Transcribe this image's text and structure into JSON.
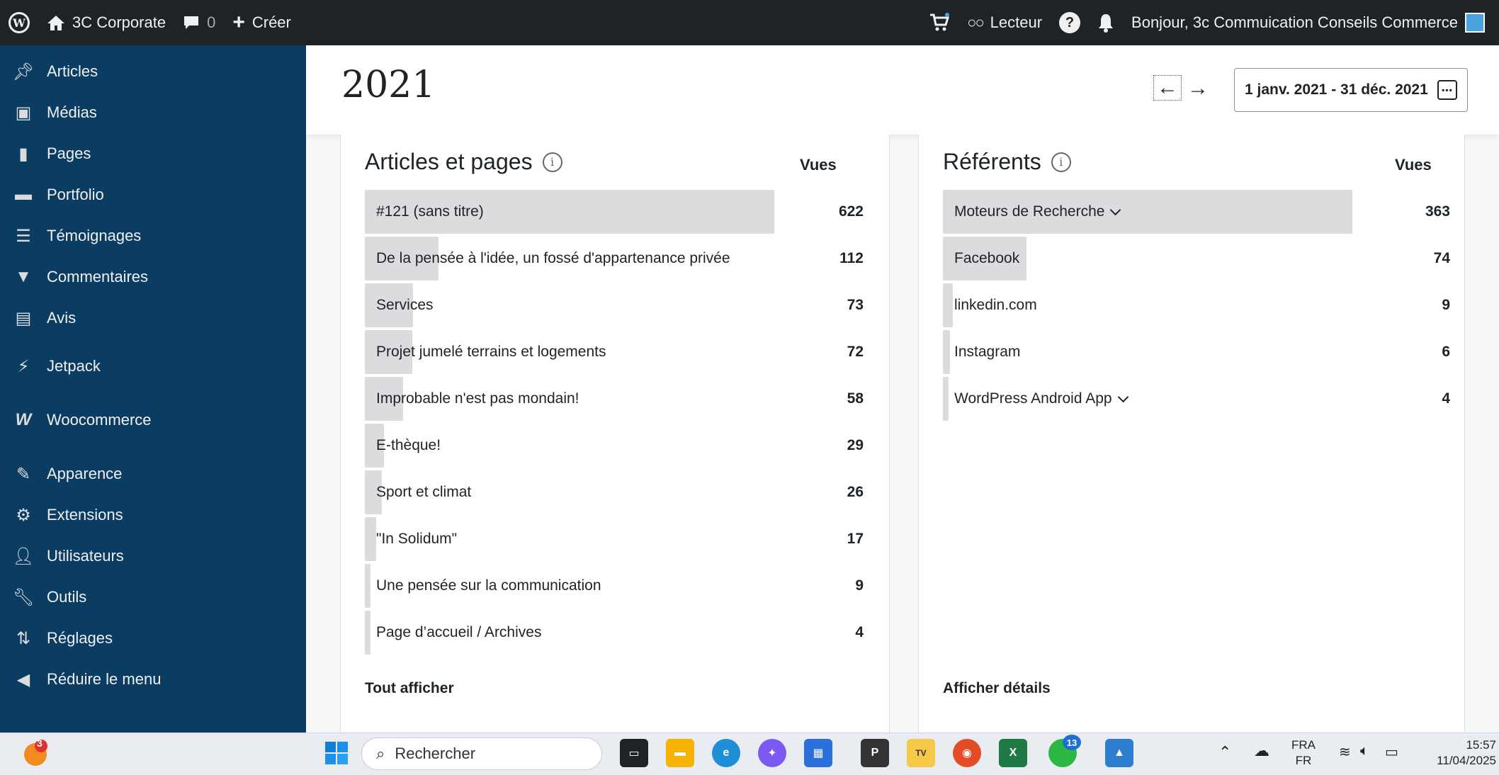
{
  "adminbar": {
    "site_name": "3C Corporate",
    "comments_count": "0",
    "create_label": "Créer",
    "reader_label": "Lecteur",
    "greeting": "Bonjour, 3c Commuication Conseils Commerce"
  },
  "sidebar": {
    "items": [
      {
        "label": "Articles",
        "icon": "pin-icon"
      },
      {
        "label": "Médias",
        "icon": "media-icon"
      },
      {
        "label": "Pages",
        "icon": "page-icon"
      },
      {
        "label": "Portfolio",
        "icon": "folder-icon"
      },
      {
        "label": "Témoignages",
        "icon": "testimonial-icon"
      },
      {
        "label": "Commentaires",
        "icon": "comment-icon"
      },
      {
        "label": "Avis",
        "icon": "review-icon"
      },
      {
        "label": "Jetpack",
        "icon": "jetpack-icon"
      },
      {
        "label": "Woocommerce",
        "icon": "woo-icon"
      },
      {
        "label": "Apparence",
        "icon": "brush-icon"
      },
      {
        "label": "Extensions",
        "icon": "plugin-icon"
      },
      {
        "label": "Utilisateurs",
        "icon": "user-icon"
      },
      {
        "label": "Outils",
        "icon": "wrench-icon"
      },
      {
        "label": "Réglages",
        "icon": "settings-icon"
      },
      {
        "label": "Réduire le menu",
        "icon": "collapse-icon"
      }
    ]
  },
  "header": {
    "year": "2021",
    "date_range": "1 janv. 2021 - 31 déc. 2021"
  },
  "posts": {
    "title": "Articles et pages",
    "col_label": "Vues",
    "footer": "Tout afficher",
    "rows": [
      {
        "label": "#121 (sans titre)",
        "value": "622",
        "ratio": 1.0
      },
      {
        "label": "De la pensée à l'idée, un fossé d'appartenance privée",
        "value": "112",
        "ratio": 0.18
      },
      {
        "label": "Services",
        "value": "73",
        "ratio": 0.117
      },
      {
        "label": "Projet jumelé terrains et logements",
        "value": "72",
        "ratio": 0.116
      },
      {
        "label": "Improbable n'est pas mondain!",
        "value": "58",
        "ratio": 0.093
      },
      {
        "label": "E-thèque!",
        "value": "29",
        "ratio": 0.047
      },
      {
        "label": "Sport et climat",
        "value": "26",
        "ratio": 0.042
      },
      {
        "label": "\"In Solidum\"",
        "value": "17",
        "ratio": 0.027
      },
      {
        "label": "Une pensée sur la communication",
        "value": "9",
        "ratio": 0.014
      },
      {
        "label": "Page d’accueil / Archives",
        "value": "4",
        "ratio": 0.006
      }
    ]
  },
  "referrers": {
    "title": "Référents",
    "col_label": "Vues",
    "footer": "Afficher détails",
    "rows": [
      {
        "label": "Moteurs de Recherche",
        "value": "363",
        "ratio": 1.0,
        "expandable": true
      },
      {
        "label": "Facebook",
        "value": "74",
        "ratio": 0.204,
        "expandable": false
      },
      {
        "label": "linkedin.com",
        "value": "9",
        "ratio": 0.025,
        "expandable": false
      },
      {
        "label": "Instagram",
        "value": "6",
        "ratio": 0.017,
        "expandable": false
      },
      {
        "label": "WordPress Android App",
        "value": "4",
        "ratio": 0.011,
        "expandable": true
      }
    ]
  },
  "taskbar": {
    "search_placeholder": "Rechercher",
    "notif_badge": "3",
    "whatsapp_badge": "13",
    "lang_top": "FRA",
    "lang_bottom": "FR",
    "time": "15:57",
    "date": "11/04/2025"
  }
}
